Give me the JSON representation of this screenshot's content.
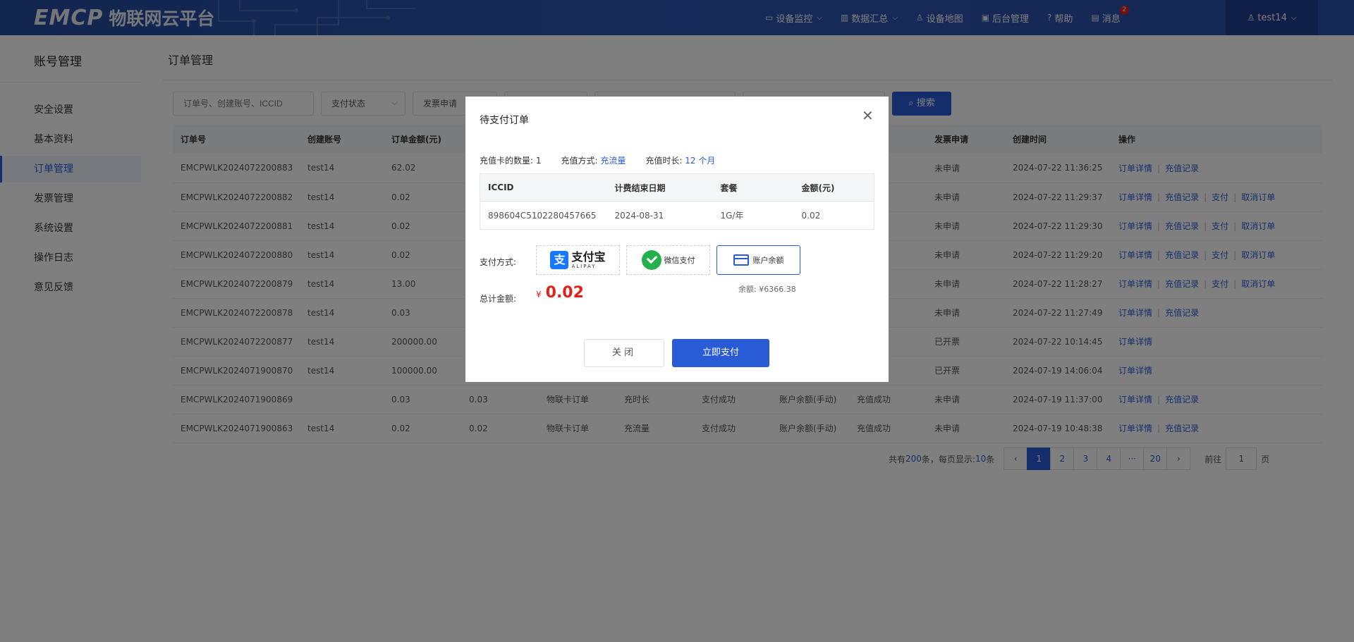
{
  "header": {
    "logo_emcp": "EMCP",
    "logo_text": "物联网云平台",
    "nav": [
      {
        "icon": "monitor-icon",
        "label": "设备监控",
        "caret": true
      },
      {
        "icon": "chart-icon",
        "label": "数据汇总",
        "caret": true
      },
      {
        "icon": "map-person-icon",
        "label": "设备地图",
        "caret": false
      },
      {
        "icon": "admin-icon",
        "label": "后台管理",
        "caret": false
      },
      {
        "icon": "help-icon",
        "label": "帮助",
        "caret": false
      },
      {
        "icon": "message-icon",
        "label": "消息",
        "caret": false,
        "badge": "2"
      }
    ],
    "user": "test14"
  },
  "sidebar": {
    "title": "账号管理",
    "items": [
      {
        "label": "安全设置"
      },
      {
        "label": "基本资料"
      },
      {
        "label": "订单管理",
        "active": true
      },
      {
        "label": "发票管理"
      },
      {
        "label": "系统设置"
      },
      {
        "label": "操作日志"
      },
      {
        "label": "意见反馈"
      }
    ]
  },
  "main": {
    "title": "订单管理",
    "filters": {
      "search_placeholder": "订单号、创建账号、ICCID",
      "pay_status": "支付状态",
      "invoice": "发票申请"
    },
    "search_button": "搜索",
    "table": {
      "headers": [
        "订单号",
        "创建账号",
        "订单金额(元)",
        "",
        "",
        "",
        "",
        "",
        "",
        "发票申请",
        "创建时间",
        "操作"
      ],
      "rows": [
        {
          "id": "EMCPWLK2024072200883",
          "account": "test14",
          "amount": "62.02",
          "paid": "",
          "type": "",
          "method": "",
          "status": "",
          "pay": "",
          "recharge": "",
          "invoice": "未申请",
          "time": "2024-07-22 11:36:25",
          "ops": [
            "订单详情",
            "充值记录"
          ]
        },
        {
          "id": "EMCPWLK2024072200882",
          "account": "test14",
          "amount": "0.02",
          "paid": "",
          "type": "",
          "method": "",
          "status": "",
          "pay": "",
          "recharge": "",
          "invoice": "未申请",
          "time": "2024-07-22 11:29:37",
          "ops": [
            "订单详情",
            "充值记录",
            "支付",
            "取消订单"
          ]
        },
        {
          "id": "EMCPWLK2024072200881",
          "account": "test14",
          "amount": "0.02",
          "paid": "",
          "type": "",
          "method": "",
          "status": "",
          "pay": "",
          "recharge": "",
          "invoice": "未申请",
          "time": "2024-07-22 11:29:30",
          "ops": [
            "订单详情",
            "充值记录",
            "支付",
            "取消订单"
          ]
        },
        {
          "id": "EMCPWLK2024072200880",
          "account": "test14",
          "amount": "0.02",
          "paid": "",
          "type": "",
          "method": "",
          "status": "",
          "pay": "",
          "recharge": "",
          "invoice": "未申请",
          "time": "2024-07-22 11:29:20",
          "ops": [
            "订单详情",
            "充值记录",
            "支付",
            "取消订单"
          ]
        },
        {
          "id": "EMCPWLK2024072200879",
          "account": "test14",
          "amount": "13.00",
          "paid": "",
          "type": "",
          "method": "",
          "status": "",
          "pay": "",
          "recharge": "",
          "invoice": "未申请",
          "time": "2024-07-22 11:28:27",
          "ops": [
            "订单详情",
            "充值记录",
            "支付",
            "取消订单"
          ]
        },
        {
          "id": "EMCPWLK2024072200878",
          "account": "test14",
          "amount": "0.03",
          "paid": "",
          "type": "",
          "method": "",
          "status": "",
          "pay": "",
          "recharge": "",
          "invoice": "未申请",
          "time": "2024-07-22 11:27:49",
          "ops": [
            "订单详情",
            "充值记录"
          ]
        },
        {
          "id": "EMCPWLK2024072200877",
          "account": "test14",
          "amount": "200000.00",
          "paid": "",
          "type": "",
          "method": "",
          "status": "",
          "pay": "",
          "recharge": "",
          "invoice": "已开票",
          "time": "2024-07-22 10:14:45",
          "ops": [
            "订单详情"
          ]
        },
        {
          "id": "EMCPWLK2024071900870",
          "account": "test14",
          "amount": "100000.00",
          "paid": "",
          "type": "",
          "method": "",
          "status": "",
          "pay": "",
          "recharge": "",
          "invoice": "已开票",
          "time": "2024-07-19 14:06:04",
          "ops": [
            "订单详情"
          ]
        },
        {
          "id": "EMCPWLK2024071900869",
          "account": "",
          "amount": "0.03",
          "paid": "0.03",
          "type": "物联卡订单",
          "method": "充时长",
          "status": "支付成功",
          "pay": "账户余额(手动)",
          "recharge": "充值成功",
          "invoice": "未申请",
          "time": "2024-07-19 11:37:00",
          "ops": [
            "订单详情",
            "充值记录"
          ]
        },
        {
          "id": "EMCPWLK2024071900863",
          "account": "test14",
          "amount": "0.02",
          "paid": "0.02",
          "type": "物联卡订单",
          "method": "充流量",
          "status": "支付成功",
          "pay": "账户余额(手动)",
          "recharge": "充值成功",
          "invoice": "未申请",
          "time": "2024-07-19 10:48:38",
          "ops": [
            "订单详情",
            "充值记录"
          ]
        }
      ]
    },
    "pager": {
      "total_prefix": "共有",
      "total": "200",
      "total_suffix": "条，每页显示:",
      "per_page": "10",
      "per_page_suffix": "条",
      "prev": "‹",
      "pages": [
        "1",
        "2",
        "3",
        "4",
        "···",
        "20"
      ],
      "next": "›",
      "goto_label": "前往",
      "goto_value": "1",
      "goto_suffix": "页"
    }
  },
  "modal": {
    "title": "待支付订单",
    "card_count_label": "充值卡的数量:",
    "card_count": "1",
    "method_label": "充值方式:",
    "method": "充流量",
    "duration_label": "充值时长:",
    "duration": "12 个月",
    "detail_headers": [
      "ICCID",
      "计费结束日期",
      "套餐",
      "金额(元)"
    ],
    "detail_row": [
      "898604C5102280457665",
      "2024-08-31",
      "1G/年",
      "0.02"
    ],
    "pay_label": "支付方式:",
    "alipay_cn": "支付宝",
    "alipay_en": "ALIPAY",
    "wechat": "微信支付",
    "balance_pay": "账户余额",
    "balance": "余额: ¥6366.38",
    "total_label": "总计金额:",
    "currency": "¥",
    "total": "0.02",
    "close_button": "关闭",
    "pay_button": "立即支付"
  },
  "colors": {
    "primary": "#2a5bd7",
    "header": "#2a4fa8",
    "price": "#e0221c"
  }
}
